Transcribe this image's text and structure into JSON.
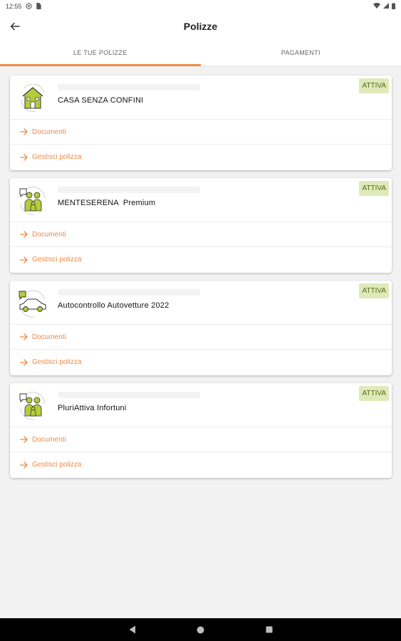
{
  "status_bar": {
    "time": "12:55"
  },
  "app_bar": {
    "title": "Polizze"
  },
  "tabs": [
    {
      "label": "LE TUE POLIZZE",
      "active": true
    },
    {
      "label": "PAGAMENTI",
      "active": false
    }
  ],
  "links": {
    "documents": "Documenti",
    "manage": "Gestisci polizza"
  },
  "policies": [
    {
      "name": "CASA SENZA CONFINI",
      "status": "ATTIVA",
      "icon": "house-icon"
    },
    {
      "name": "MENTESERENA  Premium",
      "status": "ATTIVA",
      "icon": "family-icon"
    },
    {
      "name": "Autocontrollo Autovetture 2022",
      "status": "ATTIVA",
      "icon": "car-icon"
    },
    {
      "name": "PluriAttiva Infortuni",
      "status": "ATTIVA",
      "icon": "family-icon"
    }
  ],
  "colors": {
    "accent": "#f08a46",
    "badge_bg": "#dfeaba",
    "badge_text": "#556b14",
    "icon_green": "#b5cc3c"
  }
}
